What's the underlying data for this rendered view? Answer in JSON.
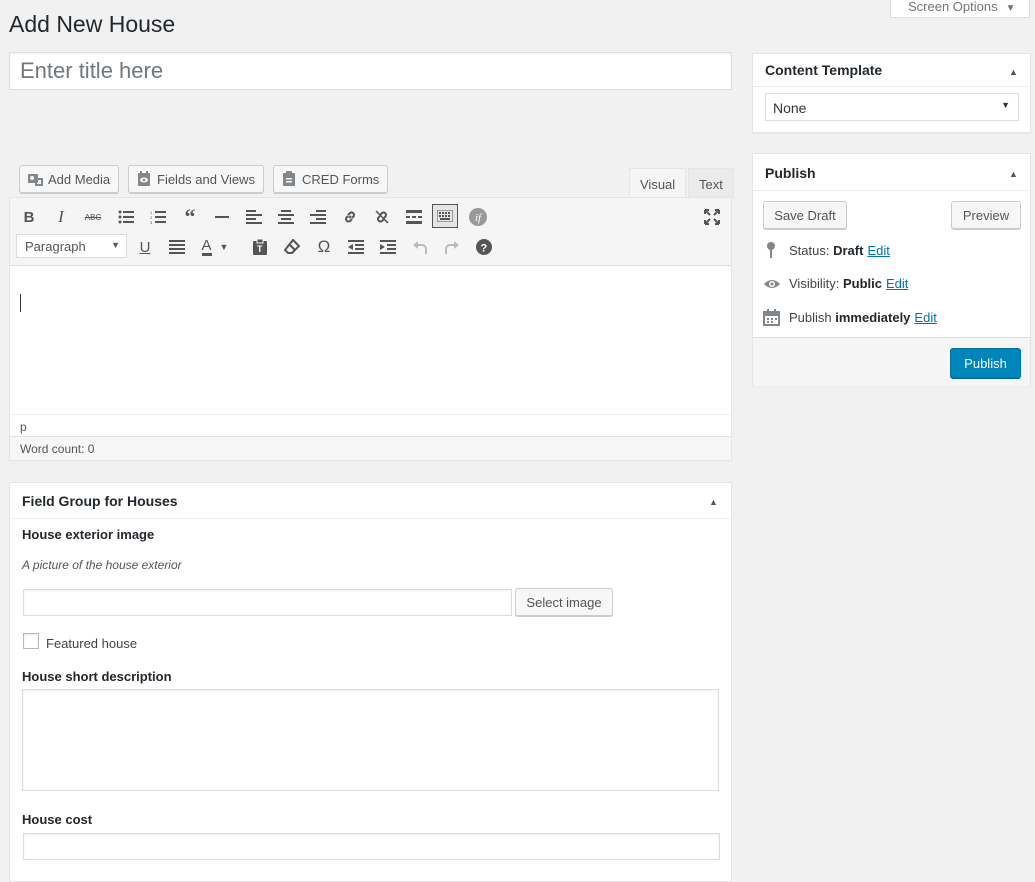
{
  "page": {
    "title": "Add New House"
  },
  "screen_options": {
    "label": "Screen Options"
  },
  "post_title": {
    "placeholder": "Enter title here",
    "value": ""
  },
  "media_buttons": [
    {
      "label": "Add Media",
      "icon": "media-icon"
    },
    {
      "label": "Fields and Views",
      "icon": "fields-views-icon"
    },
    {
      "label": "CRED Forms",
      "icon": "cred-forms-icon"
    }
  ],
  "editor": {
    "tabs": [
      {
        "label": "Visual",
        "active": true
      },
      {
        "label": "Text",
        "active": false
      }
    ],
    "format_select": "Paragraph",
    "path": "p",
    "word_count": "Word count: 0"
  },
  "content_template": {
    "title": "Content Template",
    "selected": "None"
  },
  "publish": {
    "title": "Publish",
    "save_draft": "Save Draft",
    "preview": "Preview",
    "status_label": "Status:",
    "status_value": "Draft",
    "visibility_label": "Visibility:",
    "visibility_value": "Public",
    "schedule_label": "Publish",
    "schedule_value": "immediately",
    "edit_link": "Edit",
    "publish_button": "Publish",
    "primary_color": "#0085ba"
  },
  "field_group": {
    "title": "Field Group for Houses",
    "exterior_image_label": "House exterior image",
    "exterior_image_desc": "A picture of the house exterior",
    "exterior_image_value": "",
    "select_image": "Select image",
    "featured_label": "Featured house",
    "featured_checked": false,
    "short_desc_label": "House short description",
    "short_desc_value": "",
    "cost_label": "House cost",
    "cost_value": ""
  }
}
